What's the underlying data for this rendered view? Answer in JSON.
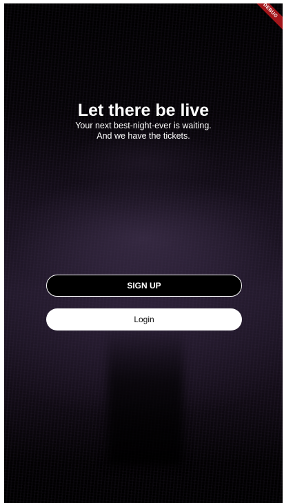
{
  "hero": {
    "title": "Let there be live",
    "subtitle_line1": "Your next best-night-ever is waiting.",
    "subtitle_line2": "And we have the tickets."
  },
  "buttons": {
    "signup_label": "SIGN UP",
    "login_label": "Login"
  },
  "debug_banner": {
    "label": "DEBUG"
  },
  "colors": {
    "background": "#000000",
    "primary_text": "#ffffff",
    "signup_border": "#ffffff",
    "login_background": "#ffffff",
    "debug_banner": "#a3161b"
  }
}
